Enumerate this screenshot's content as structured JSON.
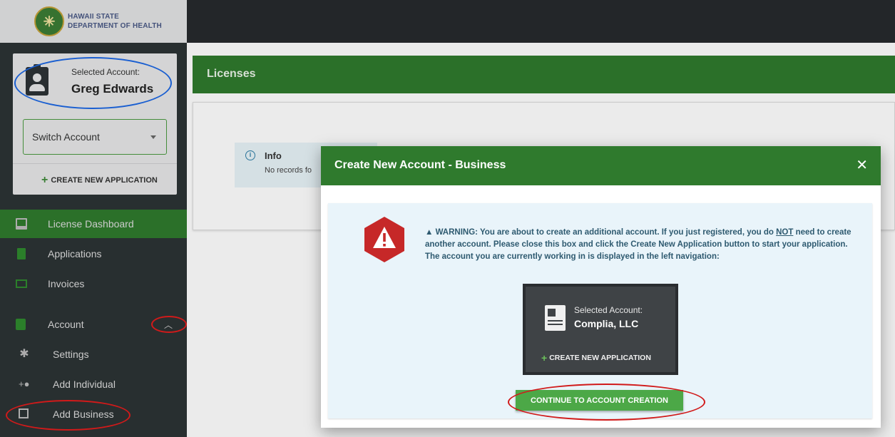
{
  "logo": {
    "line1": "HAWAII STATE",
    "line2": "DEPARTMENT OF HEALTH"
  },
  "account_card": {
    "label": "Selected Account:",
    "name": "Greg Edwards",
    "switch_label": "Switch Account",
    "create_label": "CREATE NEW APPLICATION"
  },
  "nav": {
    "license_dashboard": "License Dashboard",
    "applications": "Applications",
    "invoices": "Invoices",
    "account": "Account",
    "settings": "Settings",
    "add_individual": "Add Individual",
    "add_business": "Add Business"
  },
  "main": {
    "licenses_title": "Licenses",
    "info_title": "Info",
    "info_text": "No records fo"
  },
  "modal": {
    "title": "Create New Account - Business",
    "close_label": "✕",
    "warning_prefix": "▲ WARNING: You are about to create an additional account. If you just registered, you do ",
    "warning_not": "NOT",
    "warning_suffix": " need to create another account. Please close this box and click the Create New Application button to start your application. The account you are currently working in is displayed in the left navigation:",
    "mini_label": "Selected Account:",
    "mini_name": "Complia, LLC",
    "mini_create": "CREATE NEW APPLICATION",
    "continue_label": "CONTINUE TO ACCOUNT CREATION"
  },
  "colors": {
    "brand_green": "#2f7a2d",
    "sidebar_bg": "#2c3335",
    "warning_red": "#c62828",
    "annotation_red": "#d11a1a",
    "annotation_blue": "#1a5fd1"
  }
}
